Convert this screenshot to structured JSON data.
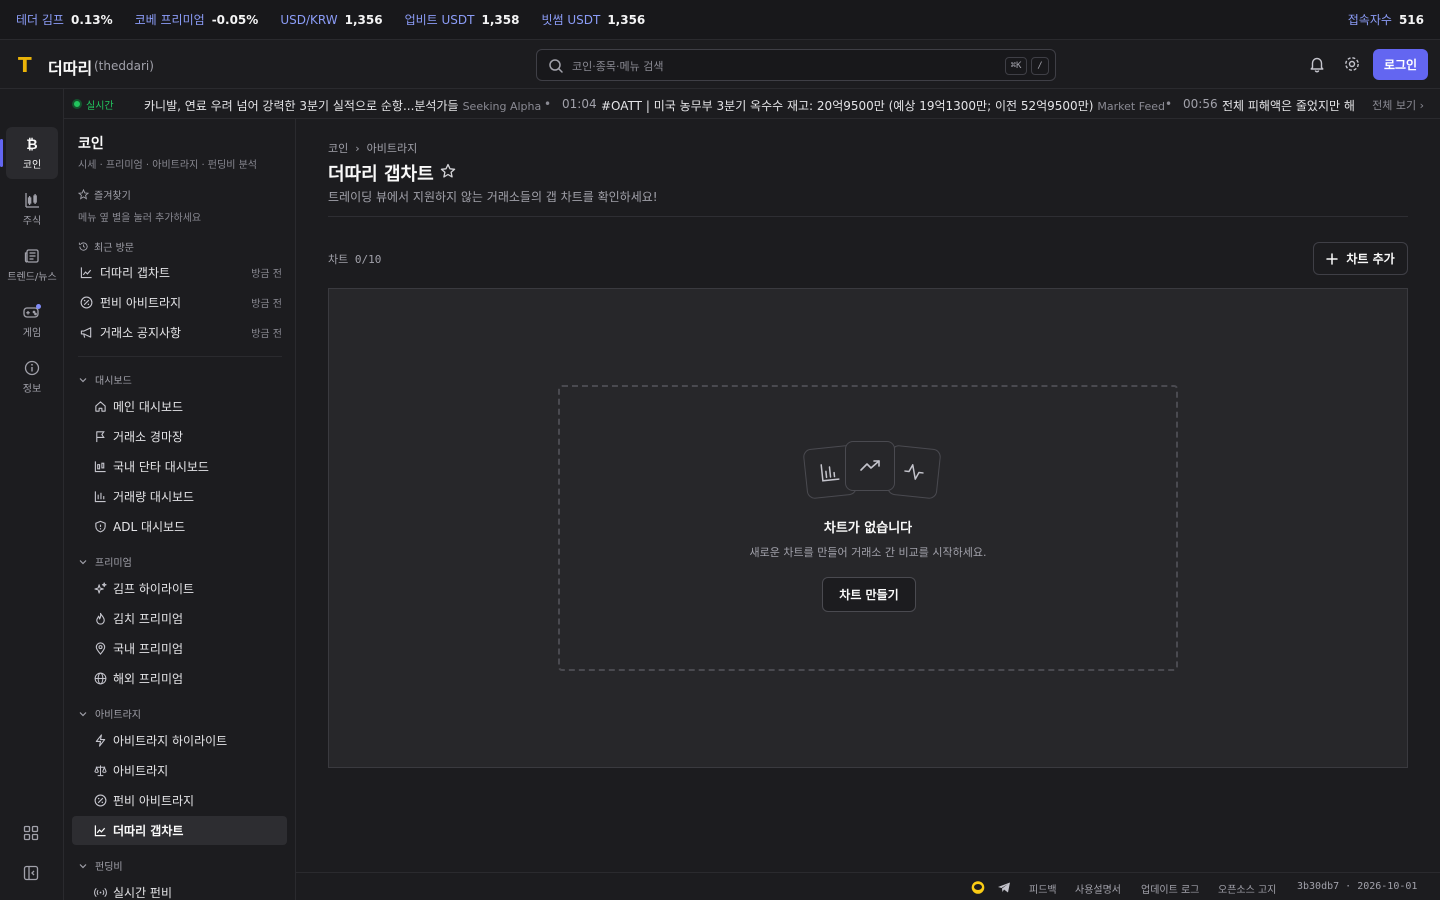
{
  "ticker": {
    "stats": [
      {
        "label": "테더 김프",
        "value": "0.13%"
      },
      {
        "label": "코베 프리미엄",
        "value": "-0.05%"
      },
      {
        "label": "USD/KRW",
        "value": "1,356"
      },
      {
        "label": "업비트 USDT",
        "value": "1,358"
      },
      {
        "label": "빗썸 USDT",
        "value": "1,356"
      }
    ],
    "online_label": "접속자수",
    "online_value": "516"
  },
  "header": {
    "logo_letter": "T",
    "brand": "더따리",
    "brand_sub": "(theddari)",
    "search_placeholder": "코인·종목·메뉴 검색",
    "kbd1": "⌘K",
    "kbd2": "/",
    "login_label": "로그인"
  },
  "news": {
    "live_label": "실시간",
    "items": [
      {
        "time": "",
        "title": "카니발, 연료 우려 넘어 강력한 3분기 실적으로 순항...분석가들",
        "source": "Seeking Alpha"
      },
      {
        "time": "01:04",
        "title": "#OATT | 미국 농무부 3분기 옥수수 재고: 20억9500만 (예상 19억1300만; 이전 52억9500만)",
        "source": "Market Feed"
      },
      {
        "time": "00:56",
        "title": "전체 피해액은 줄었지만 해",
        "source": ""
      }
    ],
    "view_all": "전체 보기 ›"
  },
  "rail": {
    "items": [
      {
        "label": "코인",
        "icon": "bitcoin-icon",
        "active": true
      },
      {
        "label": "주식",
        "icon": "candlestick-icon",
        "active": false
      },
      {
        "label": "트렌드/뉴스",
        "icon": "newspaper-icon",
        "active": false
      },
      {
        "label": "게임",
        "icon": "gamepad-icon",
        "active": false
      },
      {
        "label": "정보",
        "icon": "info-icon",
        "active": false
      }
    ]
  },
  "sidebar": {
    "title": "코인",
    "subtitle": "시세 · 프리미엄 · 아비트라지 · 펀딩비 분석",
    "favorites_label": "즐겨찾기",
    "favorites_hint": "메뉴 옆 별을 눌러 추가하세요",
    "recent_label": "최근 방문",
    "recent": [
      {
        "label": "더따리 갭차트",
        "when": "방금 전"
      },
      {
        "label": "펀비 아비트라지",
        "when": "방금 전"
      },
      {
        "label": "거래소 공지사항",
        "when": "방금 전"
      }
    ],
    "groups": [
      {
        "label": "대시보드",
        "items": [
          "메인 대시보드",
          "거래소 경마장",
          "국내 단타 대시보드",
          "거래량 대시보드",
          "ADL 대시보드"
        ]
      },
      {
        "label": "프리미엄",
        "items": [
          "김프 하이라이트",
          "김치 프리미엄",
          "국내 프리미엄",
          "해외 프리미엄"
        ]
      },
      {
        "label": "아비트라지",
        "items": [
          "아비트라지 하이라이트",
          "아비트라지",
          "펀비 아비트라지",
          "더따리 갭차트"
        ]
      },
      {
        "label": "펀딩비",
        "items": [
          "실시간 펀비"
        ]
      }
    ]
  },
  "main": {
    "breadcrumb": [
      "코인",
      "아비트라지"
    ],
    "title": "더따리 갭차트",
    "description": "트레이딩 뷰에서 지원하지 않는 거래소들의 갭 차트를 확인하세요!",
    "counter": "차트 0/10",
    "add_button": "차트 추가",
    "empty_title": "차트가 없습니다",
    "empty_desc": "새로운 차트를 만들어 거래소 간 비교를 시작하세요.",
    "create_button": "차트 만들기"
  },
  "footer": {
    "feedback": "피드백",
    "manual": "사용설명서",
    "changelog": "업데이트 로그",
    "oss": "오픈소스 고지",
    "version": "3b30db7 · 2026-10-01"
  },
  "colors": {
    "accent": "#6366f1",
    "live": "#22c55e",
    "logo": "#eab308",
    "label_blue": "#8b9cf7"
  }
}
